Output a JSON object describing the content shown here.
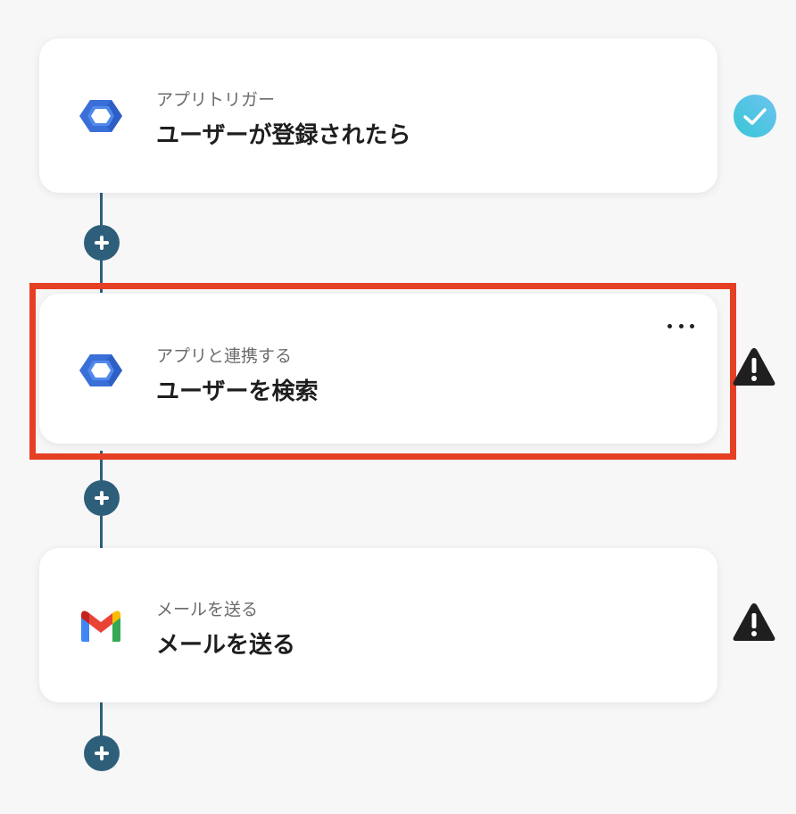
{
  "steps": [
    {
      "subtitle": "アプリトリガー",
      "title": "ユーザーが登録されたら",
      "app_icon": "google-workspace-hexagon-icon",
      "status": "completed",
      "status_icon": "check-circle-icon"
    },
    {
      "subtitle": "アプリと連携する",
      "title": "ユーザーを検索",
      "app_icon": "google-workspace-hexagon-icon",
      "status": "warning",
      "status_icon": "warning-triangle-icon",
      "highlighted": true,
      "menu_icon": "more-horizontal-icon"
    },
    {
      "subtitle": "メールを送る",
      "title": "メールを送る",
      "app_icon": "gmail-icon",
      "status": "warning",
      "status_icon": "warning-triangle-icon"
    }
  ],
  "add_step_icon": "plus-icon",
  "colors": {
    "background": "#f7f7f8",
    "connector": "#2e5f7a",
    "highlight_border": "#e53f24",
    "check_gradient_start": "#39c6d6",
    "check_gradient_end": "#6cc3f0",
    "warning": "#1f1f1f"
  }
}
